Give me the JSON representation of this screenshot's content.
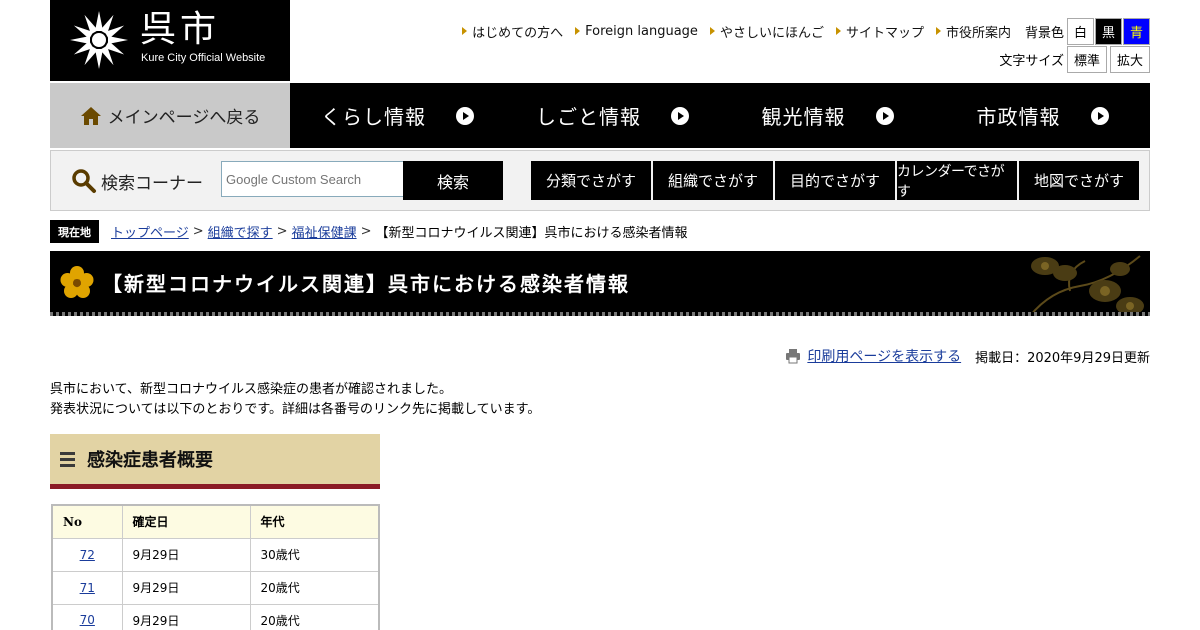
{
  "header": {
    "site_name": "呉市",
    "site_subtitle": "Kure City Official Website",
    "links": [
      "はじめての方へ",
      "Foreign language",
      "やさしいにほんご",
      "サイトマップ",
      "市役所案内"
    ],
    "bg_color_label": "背景色",
    "bg_colors": [
      {
        "label": "白",
        "bg": "#ffffff",
        "fg": "#000000"
      },
      {
        "label": "黒",
        "bg": "#000000",
        "fg": "#ffffff"
      },
      {
        "label": "青",
        "bg": "#0000ff",
        "fg": "#ffff00"
      }
    ],
    "text_size_label": "文字サイズ",
    "text_size_standard": "標準",
    "text_size_large": "拡大"
  },
  "nav": {
    "home": "メインページへ戻る",
    "items": [
      "くらし情報",
      "しごと情報",
      "観光情報",
      "市政情報"
    ]
  },
  "search": {
    "label": "検索コーナー",
    "placeholder": "Google Custom Search",
    "button": "検索",
    "categories": [
      "分類でさがす",
      "組織でさがす",
      "目的でさがす",
      "カレンダーでさがす",
      "地図でさがす"
    ]
  },
  "breadcrumb": {
    "here_label": "現在地",
    "links": [
      "トップページ",
      "組織で探す",
      "福祉保健課"
    ],
    "current": "【新型コロナウイルス関連】呉市における感染者情報"
  },
  "page": {
    "title": "【新型コロナウイルス関連】呉市における感染者情報",
    "print_link": "印刷用ページを表示する",
    "posted": "掲載日：2020年9月29日更新",
    "intro": [
      "呉市において、新型コロナウイルス感染症の患者が確認されました。",
      "発表状況については以下のとおりです。詳細は各番号のリンク先に掲載しています。"
    ],
    "section_title": "感染症患者概要"
  },
  "table": {
    "headers": [
      "No",
      "確定日",
      "年代"
    ],
    "rows": [
      {
        "no": "72",
        "date": "9月29日",
        "age": "30歳代"
      },
      {
        "no": "71",
        "date": "9月29日",
        "age": "20歳代"
      },
      {
        "no": "70",
        "date": "9月29日",
        "age": "20歳代"
      }
    ]
  },
  "icons": [
    "kure-city-emblem-icon",
    "home-icon",
    "arrow-circle-icon",
    "search-icon",
    "printer-icon",
    "flower-emblem-icon",
    "hamburger-icon"
  ],
  "colors": {
    "accent_gold": "#c79200",
    "link": "#1a3c9b",
    "section_bg": "#e2d3a4",
    "section_border": "#8b1a25"
  }
}
